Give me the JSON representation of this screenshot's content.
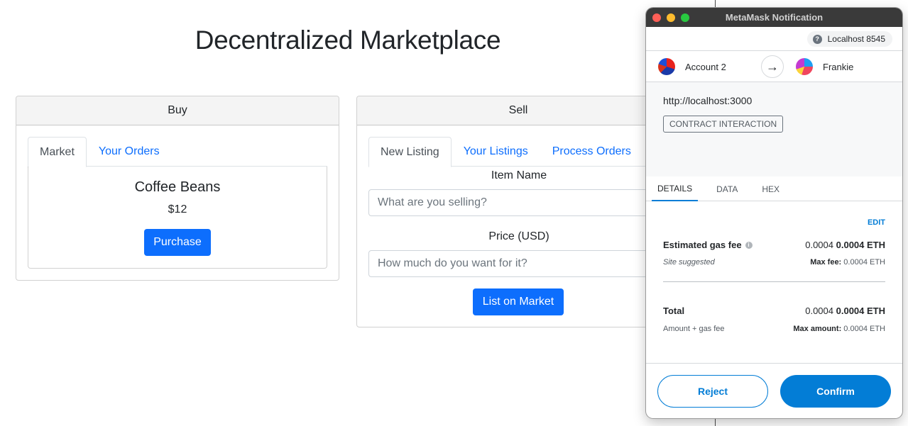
{
  "page": {
    "title": "Decentralized Marketplace"
  },
  "buy": {
    "header": "Buy",
    "tabs": [
      "Market",
      "Your Orders"
    ],
    "product": {
      "name": "Coffee Beans",
      "price": "$12",
      "button": "Purchase"
    }
  },
  "sell": {
    "header": "Sell",
    "tabs": [
      "New Listing",
      "Your Listings",
      "Process Orders"
    ],
    "item_label": "Item Name",
    "item_placeholder": "What are you selling?",
    "price_label": "Price (USD)",
    "price_placeholder": "How much do you want for it?",
    "button": "List on Market"
  },
  "metamask": {
    "window_title": "MetaMask Notification",
    "network": "Localhost 8545",
    "from_account": "Account 2",
    "to_account": "Frankie",
    "origin": "http://localhost:3000",
    "badge": "CONTRACT INTERACTION",
    "tabs": [
      "DETAILS",
      "DATA",
      "HEX"
    ],
    "edit": "EDIT",
    "gas": {
      "label": "Estimated gas fee",
      "value": "0.0004",
      "value_bold": "0.0004 ETH",
      "sub_label": "Site suggested",
      "max_label": "Max fee:",
      "max_value": "0.0004 ETH"
    },
    "total": {
      "label": "Total",
      "value": "0.0004",
      "value_bold": "0.0004 ETH",
      "sub_label": "Amount + gas fee",
      "max_label": "Max amount:",
      "max_value": "0.0004 ETH"
    },
    "reject": "Reject",
    "confirm": "Confirm",
    "colors": {
      "accent": "#037dd6",
      "titlebar": "#3a3a3a"
    }
  },
  "icons": {
    "arrow": "→",
    "question": "?",
    "info": "i"
  }
}
